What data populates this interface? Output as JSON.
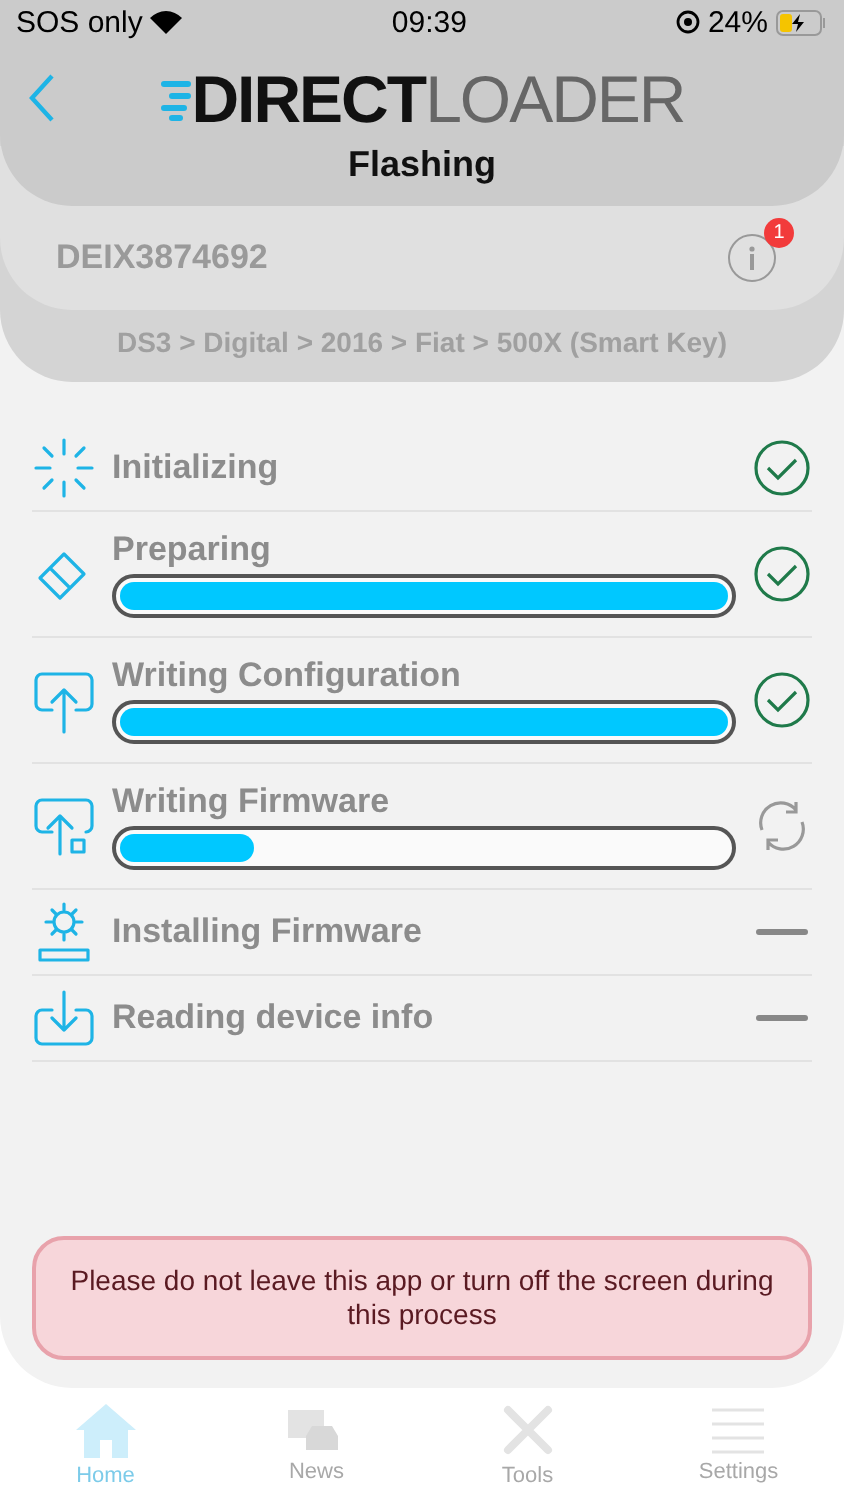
{
  "status_bar": {
    "carrier": "SOS only",
    "time": "09:39",
    "battery": "24%"
  },
  "header": {
    "logo": {
      "part_1": "DIRECT",
      "part_2": "LOADER"
    },
    "title": "Flashing"
  },
  "device": {
    "serial": "DEIX3874692",
    "info_badge": "1"
  },
  "breadcrumb": "DS3 > Digital > 2016 > Fiat > 500X (Smart Key)",
  "steps": [
    {
      "label": "Initializing",
      "kind": "done"
    },
    {
      "label": "Preparing",
      "kind": "done",
      "level": 1
    },
    {
      "label": "Writing Configuration",
      "kind": "done",
      "level": 1
    },
    {
      "label": "Writing Firmware",
      "kind": "running",
      "level": 0.22
    },
    {
      "label": "Installing Firmware",
      "kind": "pending"
    },
    {
      "label": "Reading device info",
      "kind": "pending"
    }
  ],
  "warning": "Please do not leave this app or turn off the screen during this process",
  "tab_bar": [
    {
      "label": "Home",
      "selected": true
    },
    {
      "label": "News",
      "selected": false
    },
    {
      "label": "Tools",
      "selected": false
    },
    {
      "label": "Settings",
      "selected": false
    }
  ]
}
